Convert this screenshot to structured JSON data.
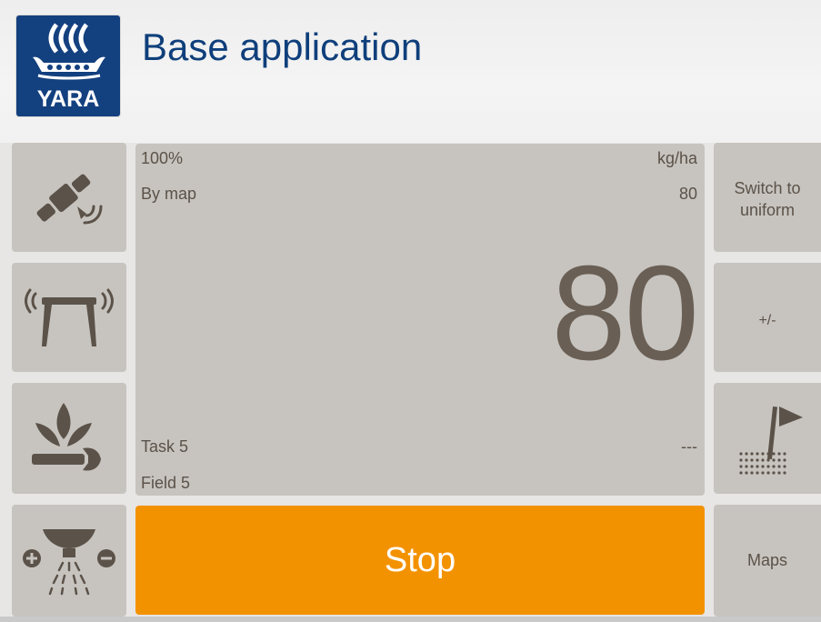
{
  "header": {
    "title": "Base application",
    "logo_text": "YARA",
    "logo_color": "#13407f",
    "title_color": "#0f3f7b"
  },
  "left_panel": [
    {
      "icon": "satellite-icon"
    },
    {
      "icon": "boom-sensor-icon"
    },
    {
      "icon": "crop-settings-icon"
    },
    {
      "icon": "spreader-rate-icon"
    }
  ],
  "display": {
    "rate_percent": "100%",
    "unit": "kg/ha",
    "mode": "By map",
    "map_rate": "80",
    "current_rate": "80",
    "task": "Task 5",
    "task_value": "---",
    "field": "Field 5"
  },
  "stop_button": {
    "label": "Stop",
    "color": "#f39200"
  },
  "right_panel": {
    "switch_label_line1": "Switch to",
    "switch_label_line2": "uniform",
    "adjust_label": "+/-",
    "headland_icon": "field-flag-icon",
    "maps_label": "Maps"
  },
  "colors": {
    "tile": "#c7c4bf",
    "text": "#5b5249"
  }
}
